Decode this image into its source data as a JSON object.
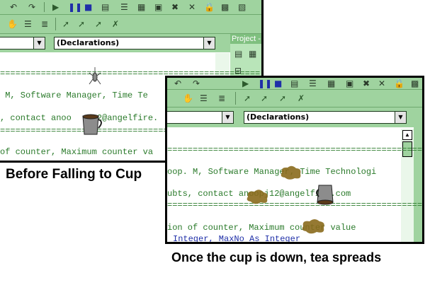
{
  "editor_before": {
    "toolbar_top_icons": [
      "undo-icon",
      "redo-icon",
      "run-icon",
      "pause-icon",
      "stop-icon",
      "project-explorer-icon",
      "properties-icon",
      "object-browser-icon",
      "toolbox-icon",
      "tools-icon",
      "lock-icon",
      "data-view-icon"
    ],
    "toolbar_second_icons": [
      "hand-icon",
      "indent-icon",
      "outdent-icon",
      "toggle-breakpoint-icon",
      "next-bookmark-icon",
      "previous-bookmark-icon",
      "clear-bookmarks-icon"
    ],
    "procedure_combo": "(Declarations)",
    "project_panel_title": "Project -",
    "code_lines": [
      "===================================================",
      " M, Software Manager, Time Te",
      ", contact anoo     2@angelfire.",
      "===================================================",
      "of counter, Maximum counter va"
    ]
  },
  "editor_after": {
    "procedure_combo": "(Declarations)",
    "code_lines": [
      "===================================================",
      "oop. M, Software Manager, Time Technologi",
      "ubts, contact anoopj12@angelfire.com",
      "===================================================",
      "ion of counter, Maximum counter value"
    ],
    "code_declaration": "Integer, MaxNo As Integer"
  },
  "captions": {
    "before": "Before Falling to Cup",
    "after": "Once the cup is down, tea spreads"
  },
  "colors": {
    "toolbar": "#9fd39f",
    "code_text": "#2a7a2a",
    "keyword": "#1f2fa8",
    "tea_stain": "#8a6a1c"
  }
}
